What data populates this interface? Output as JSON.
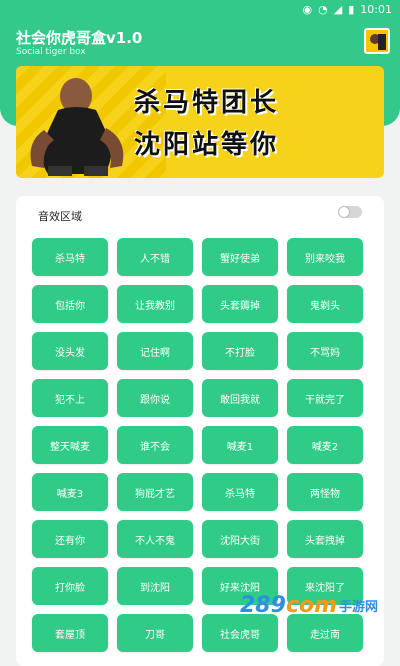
{
  "status_bar": {
    "time": "10:01"
  },
  "header": {
    "title": "社会你虎哥盒v1.0",
    "subtitle": "Social tiger box"
  },
  "banner": {
    "line1": "杀马特团长",
    "line2": "沈阳站等你"
  },
  "sound_section": {
    "title": "音效区域",
    "toggle_on": false
  },
  "buttons": [
    "杀马特",
    "人不错",
    "蟹好使弟",
    "别来咬我",
    "包括你",
    "让我教别",
    "头套薅掉",
    "鬼剃头",
    "没头发",
    "记住啊",
    "不打脸",
    "不骂妈",
    "犯不上",
    "跟你说",
    "敢回我就",
    "干就完了",
    "整天喊麦",
    "谁不会",
    "喊麦1",
    "喊麦2",
    "喊麦3",
    "狗屁才艺",
    "杀马特",
    "两怪物",
    "还有你",
    "不人不鬼",
    "沈阳大街",
    "头套拽掉",
    "打你脸",
    "到沈阳",
    "好来沈阳",
    "来沈阳了",
    "套屋顶",
    "刀哥",
    "社会虎哥",
    "走过南"
  ],
  "watermark": {
    "logo": "289",
    "logo_suffix": "com",
    "text": "手游网"
  },
  "colors": {
    "accent": "#34c98b",
    "button": "#2fcb87",
    "banner": "#f6d21a"
  }
}
